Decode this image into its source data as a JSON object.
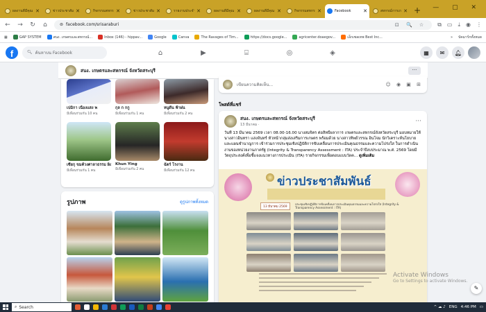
{
  "browser": {
    "tabs": [
      {
        "label": "ผลงานดีมีคุณ",
        "close": "✕"
      },
      {
        "label": "ข่าวประชาสัมพันธ์",
        "close": "✕"
      },
      {
        "label": "กิจกรรมสหกรณ์",
        "close": "✕"
      },
      {
        "label": "ข่าวประชาสัมพันธ์",
        "close": "✕"
      },
      {
        "label": "รายงานประจำเดือน",
        "close": "✕"
      },
      {
        "label": "ผลงานดีมีคุณ",
        "close": "✕"
      },
      {
        "label": "ผลงานดีมีคุณ",
        "close": "✕"
      },
      {
        "label": "กิจกรรมสหกรณ์",
        "close": "✕"
      },
      {
        "label": "Facebook",
        "close": "✕"
      },
      {
        "label": "สหกรณ์การเกษตร",
        "close": "✕"
      }
    ],
    "new_tab": "+",
    "window_controls": "— ▢ ✕",
    "url": "facebook.com/srisaraburi",
    "bookmarks": [
      {
        "label": "GAP SYSTEM",
        "color": "#2d7d46"
      },
      {
        "label": "สนง. เกษตรและสหกรณ์...",
        "color": "#1877f2"
      },
      {
        "label": "Inbox (146) - hippav...",
        "color": "#d93025"
      },
      {
        "label": "Google",
        "color": "#4285f4"
      },
      {
        "label": "Canva",
        "color": "#00c4cc"
      },
      {
        "label": "The Ravages of Tim...",
        "color": "#e8a900"
      },
      {
        "label": "https://docs.google...",
        "color": "#0f9d58"
      },
      {
        "label": "agricenter.doaegov...",
        "color": "#34a853"
      },
      {
        "label": "เอ็กเซลเทพ Best Inc...",
        "color": "#ff6d00"
      }
    ],
    "bookmarks_more": "»",
    "bookmarks_folder": "บัคมาร์กทั้งหมด"
  },
  "facebook": {
    "logo": "f",
    "search_placeholder": "ค้นหาบน Facebook",
    "nav_icons": [
      "home-icon",
      "video-icon",
      "marketplace-icon",
      "groups-icon",
      "gaming-icon"
    ],
    "page_name": "สนง. เกษตรและสหกรณ์ จังหวัดสระบุรี",
    "more_label": "···"
  },
  "friends": [
    {
      "name": "เปมิกา เนื่องแสง พ",
      "mutual": "มีเพื่อนร่วมกัน 10 คน"
    },
    {
      "name": "กุล ก กกู",
      "mutual": "มีเพื่อนร่วมกัน 1 คน"
    },
    {
      "name": "หนูดีน ฟ้าฝน",
      "mutual": "มีเพื่อนร่วมกัน 2 คน"
    },
    {
      "name": "เซียกุ ขมค้วงศาลาธรรม ผิงวาย",
      "mutual": "มีเพื่อนร่วมกัน 1 คน"
    },
    {
      "name": "Khun Ying",
      "mutual": "มีเพื่อนร่วมกัน 2 คน"
    },
    {
      "name": "ฉัตร์ โรงาน",
      "mutual": "มีเพื่อนร่วมกัน 12 คน"
    }
  ],
  "photos": {
    "title": "รูปภาพ",
    "see_all": "ดูรูปภาพทั้งหมด"
  },
  "composer": {
    "placeholder": "เขียนความคิดเห็น..."
  },
  "section_label": "โพสต์ที่แชร์",
  "post": {
    "author": "สนง. เกษตรและสหกรณ์ จังหวัดสระบุรี",
    "date": "13 มีนาคม ·",
    "dots": "···",
    "text": "วันที่ 13 มีนาคม 2569 เวลา 08.00-16.00 นางสมจิตร ต่อสิทธิ์ผลาการ เกษตรและสหกรณ์จังหวัดสระบุรี มอบหมายให้ นางสาวอินทรา แสงจันทร์ หัวหน้ากลุ่มส่งเสริมการเกษตร พร้อมด้วย นางสาวทิพย์วรรณ อินโจม นักวิเคราะห์นโยบายและแผนชำนาญการ เข้าร่วมการประชุมเชิงปฏิบัติการขับเคลื่อนการประเมินคุณธรรมและความโปร่งใส ในการดำเนินงานของหน่วยงานภาครัฐ (Integrity & Transparency Assessment : ITA) ประจำปีงบประมาณ พ.ศ. 2569 โดยมีวัตถุประสงค์เพื่อชี้แจงแนวทางการประเมิน (ITA) รายกิจกรรมเพื่อตอบแบบวัดค...",
    "see_more": "ดูเพิ่มเติม"
  },
  "news_image": {
    "title": "ข่าวประชาสัมพันธ์",
    "date_badge": "13 มีนาคม 2569",
    "subtitle": "ประชุมเชิงปฏิบัติการขับเคลื่อนการประเมินคุณธรรมและความโปร่งใส (Integrity & Transparency Assessment : ITA)"
  },
  "watermark": {
    "line1": "Activate Windows",
    "line2": "Go to Settings to activate Windows."
  },
  "taskbar": {
    "search": "Search",
    "lang": "ENG",
    "time": "4:46 PM"
  }
}
